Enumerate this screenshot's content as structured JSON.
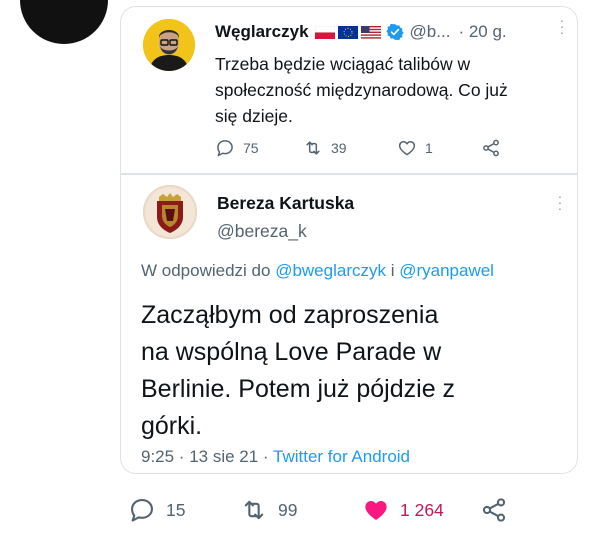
{
  "quoted": {
    "name": "Węglarczyk",
    "handle": "@b...",
    "time": "· 20 g.",
    "text_line1": "Trzeba będzie wciągać talibów w",
    "text_line2": "społeczność międzynarodową. Co już",
    "text_line3": "się dzieje.",
    "replies": "75",
    "retweets": "39",
    "likes": "1"
  },
  "tweet": {
    "name": "Bereza Kartuska",
    "handle": "@bereza_k",
    "reply_prefix": "W odpowiedzi do ",
    "reply_user1": "@bweglarczyk",
    "reply_and": " i ",
    "reply_user2": "@ryanpawel",
    "text_line1": "Zacząłbym od zaproszenia",
    "text_line2": "na wspólną Love Parade w",
    "text_line3": "Berlinie. Potem już pójdzie z",
    "text_line4": "górki.",
    "time": "9:25 · 13 sie 21 · ",
    "source": "Twitter for Android"
  },
  "actions": {
    "replies": "15",
    "retweets": "99",
    "likes": "1 264"
  },
  "colors": {
    "accent": "#1d9bf0",
    "like": "#f91880",
    "muted": "#536471"
  }
}
